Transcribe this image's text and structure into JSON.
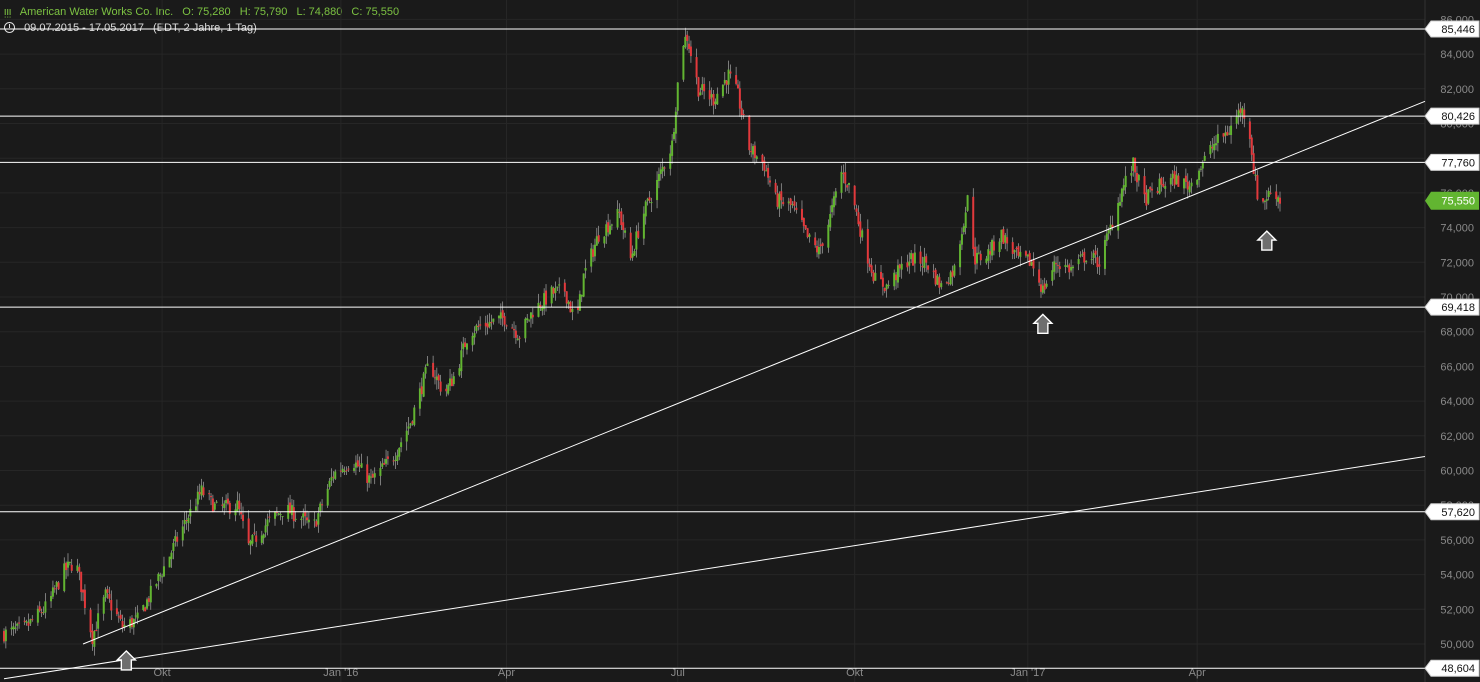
{
  "header": {
    "icon": "candlestick-icon",
    "symbol_name": "American Water Works Co. Inc.",
    "open": "O: 75,280",
    "high": "H: 75,790",
    "low": "L: 74,880",
    "close": "C: 75,550",
    "date_range": "09.07.2015 - 17.05.2017",
    "settings": "(EDT, 2 Jahre, 1 Tag)"
  },
  "colors": {
    "background": "#1a1a1a",
    "up": "#62b531",
    "down": "#e2393c",
    "line": "#ffffff",
    "grid": "#262626",
    "current_price_label": "#62b531"
  },
  "chart_data": {
    "type": "candlestick",
    "title": "American Water Works Co. Inc.",
    "x_tick_labels": [
      "Okt",
      "Jan '16",
      "Apr",
      "Jul",
      "Okt",
      "Jan '17",
      "Apr"
    ],
    "x_tick_dates": [
      "2015-10-01",
      "2016-01-04",
      "2016-04-01",
      "2016-07-01",
      "2016-10-03",
      "2017-01-03",
      "2017-04-03"
    ],
    "y_tick_labels": [
      "50,000",
      "52,000",
      "54,000",
      "56,000",
      "58,000",
      "60,000",
      "62,000",
      "64,000",
      "66,000",
      "68,000",
      "70,000",
      "72,000",
      "74,000",
      "76,000",
      "78,000",
      "80,000",
      "82,000",
      "84,000",
      "86,000"
    ],
    "ylim": [
      48.0,
      86.6
    ],
    "date_range": [
      "2015-07-09",
      "2017-05-17"
    ],
    "current_price": {
      "value": 75.55,
      "label": "75,550"
    },
    "horizontal_levels": [
      {
        "value": 85.446,
        "label": "85,446"
      },
      {
        "value": 80.426,
        "label": "80,426"
      },
      {
        "value": 77.76,
        "label": "77,760"
      },
      {
        "value": 69.418,
        "label": "69,418"
      },
      {
        "value": 57.62,
        "label": "57,620"
      },
      {
        "value": 48.604,
        "label": "48,604"
      }
    ],
    "trendlines": [
      {
        "start": {
          "date": "2015-08-20",
          "value": 50.0
        },
        "end": {
          "date": "2017-05-17",
          "value": 77.9
        }
      },
      {
        "start": {
          "date": "2015-07-09",
          "value": 48.0
        },
        "end": {
          "date": "2017-05-17",
          "value": 59.5
        }
      }
    ],
    "arrows": [
      {
        "date": "2015-09-12",
        "value": 49.6
      },
      {
        "date": "2017-01-11",
        "value": 69.0
      },
      {
        "date": "2017-05-10",
        "value": 73.8
      }
    ],
    "price_path": [
      [
        "2015-07-09",
        50.6
      ],
      [
        "2015-07-20",
        50.9
      ],
      [
        "2015-08-01",
        52.2
      ],
      [
        "2015-08-10",
        54.2
      ],
      [
        "2015-08-16",
        54.8
      ],
      [
        "2015-08-25",
        50.4
      ],
      [
        "2015-09-01",
        52.8
      ],
      [
        "2015-09-10",
        51.0
      ],
      [
        "2015-09-18",
        51.4
      ],
      [
        "2015-10-01",
        54.2
      ],
      [
        "2015-10-15",
        57.4
      ],
      [
        "2015-10-22",
        58.8
      ],
      [
        "2015-10-30",
        57.8
      ],
      [
        "2015-11-10",
        58.0
      ],
      [
        "2015-11-16",
        55.6
      ],
      [
        "2015-11-26",
        57.0
      ],
      [
        "2015-12-05",
        57.8
      ],
      [
        "2015-12-15",
        57.2
      ],
      [
        "2015-12-20",
        56.6
      ],
      [
        "2015-12-31",
        59.8
      ],
      [
        "2016-01-10",
        60.6
      ],
      [
        "2016-01-20",
        59.4
      ],
      [
        "2016-02-01",
        60.8
      ],
      [
        "2016-02-10",
        62.8
      ],
      [
        "2016-02-20",
        66.2
      ],
      [
        "2016-02-28",
        64.4
      ],
      [
        "2016-03-05",
        65.6
      ],
      [
        "2016-03-12",
        68.0
      ],
      [
        "2016-03-20",
        68.4
      ],
      [
        "2016-03-31",
        68.8
      ],
      [
        "2016-04-08",
        67.8
      ],
      [
        "2016-04-15",
        69.2
      ],
      [
        "2016-04-25",
        70.2
      ],
      [
        "2016-05-02",
        70.4
      ],
      [
        "2016-05-08",
        68.4
      ],
      [
        "2016-05-12",
        71.2
      ],
      [
        "2016-05-20",
        73.6
      ],
      [
        "2016-05-31",
        74.8
      ],
      [
        "2016-06-06",
        72.2
      ],
      [
        "2016-06-12",
        74.6
      ],
      [
        "2016-06-20",
        76.6
      ],
      [
        "2016-06-28",
        78.8
      ],
      [
        "2016-07-03",
        84.6
      ],
      [
        "2016-07-06",
        85.0
      ],
      [
        "2016-07-12",
        82.0
      ],
      [
        "2016-07-20",
        81.4
      ],
      [
        "2016-07-28",
        82.8
      ],
      [
        "2016-08-02",
        81.6
      ],
      [
        "2016-08-08",
        78.6
      ],
      [
        "2016-08-16",
        77.6
      ],
      [
        "2016-08-22",
        75.6
      ],
      [
        "2016-08-31",
        75.2
      ],
      [
        "2016-09-08",
        73.4
      ],
      [
        "2016-09-14",
        72.6
      ],
      [
        "2016-09-20",
        74.6
      ],
      [
        "2016-09-26",
        77.2
      ],
      [
        "2016-10-01",
        76.2
      ],
      [
        "2016-10-08",
        73.0
      ],
      [
        "2016-10-14",
        71.0
      ],
      [
        "2016-10-20",
        70.6
      ],
      [
        "2016-11-01",
        72.2
      ],
      [
        "2016-11-10",
        72.0
      ],
      [
        "2016-11-18",
        70.6
      ],
      [
        "2016-11-25",
        71.6
      ],
      [
        "2016-12-02",
        75.6
      ],
      [
        "2016-12-06",
        72.2
      ],
      [
        "2016-12-12",
        72.4
      ],
      [
        "2016-12-20",
        73.6
      ],
      [
        "2016-12-29",
        72.2
      ],
      [
        "2017-01-05",
        72.0
      ],
      [
        "2017-01-11",
        70.4
      ],
      [
        "2017-01-18",
        72.0
      ],
      [
        "2017-01-26",
        71.6
      ],
      [
        "2017-02-03",
        72.4
      ],
      [
        "2017-02-10",
        72.0
      ],
      [
        "2017-02-16",
        74.0
      ],
      [
        "2017-02-22",
        76.2
      ],
      [
        "2017-02-28",
        77.6
      ],
      [
        "2017-03-06",
        75.6
      ],
      [
        "2017-03-14",
        76.4
      ],
      [
        "2017-03-22",
        76.8
      ],
      [
        "2017-03-30",
        76.4
      ],
      [
        "2017-04-05",
        77.6
      ],
      [
        "2017-04-12",
        78.8
      ],
      [
        "2017-04-20",
        79.6
      ],
      [
        "2017-04-26",
        80.8
      ],
      [
        "2017-04-30",
        80.4
      ],
      [
        "2017-05-03",
        77.4
      ],
      [
        "2017-05-06",
        75.2
      ],
      [
        "2017-05-10",
        75.8
      ],
      [
        "2017-05-14",
        76.2
      ],
      [
        "2017-05-17",
        75.55
      ]
    ]
  }
}
